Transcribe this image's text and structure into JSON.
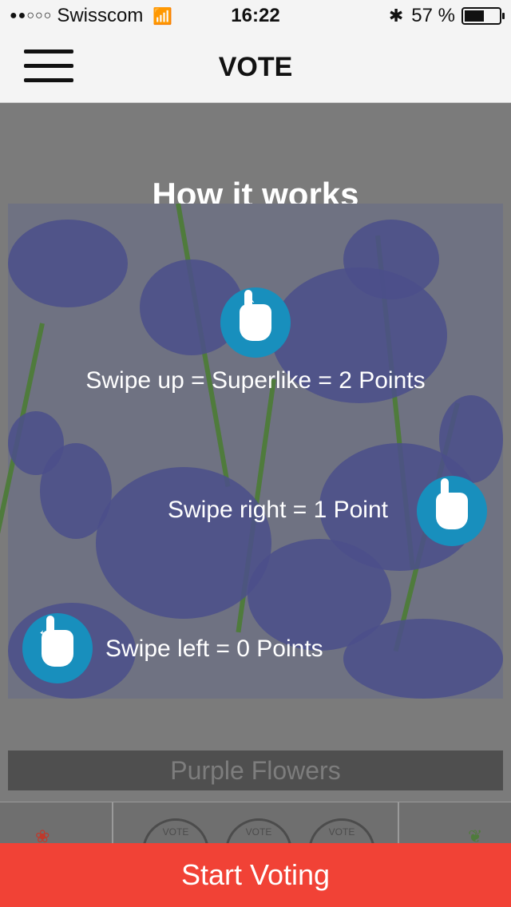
{
  "status_bar": {
    "carrier": "Swisscom",
    "time": "16:22",
    "battery": "57 %",
    "battery_level": 0.57,
    "icons": [
      "signal-dots",
      "wifi",
      "bluetooth",
      "battery"
    ]
  },
  "nav": {
    "title": "VOTE",
    "menu_icon": "hamburger-menu"
  },
  "how_it_works": {
    "title": "How it works",
    "up": "Swipe up = Superlike = 2 Points",
    "right": "Swipe right = 1 Point",
    "left": "Swipe left = 0 Points"
  },
  "current_item": {
    "name": "Purple Flowers"
  },
  "stamp_labels": [
    "VOTE",
    "VOTE",
    "VOTE"
  ],
  "cta": {
    "label": "Start Voting"
  }
}
